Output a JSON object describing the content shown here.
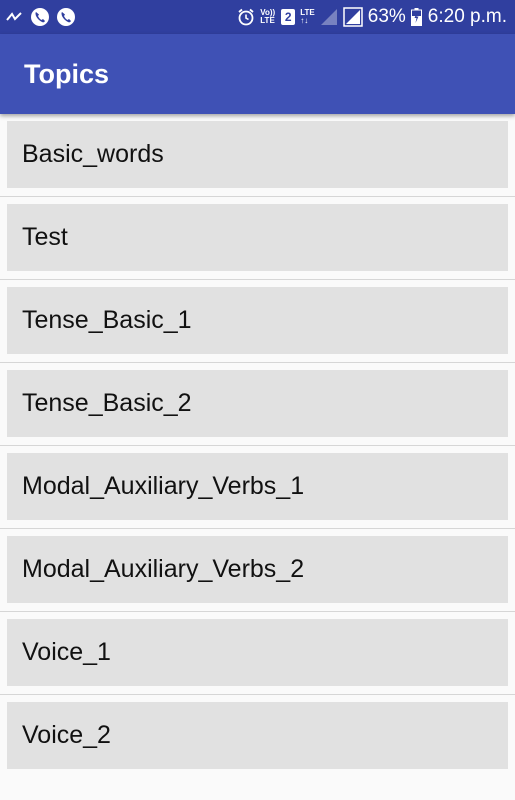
{
  "status_bar": {
    "signal_text": "63%",
    "time": "6:20 p.m.",
    "sim_slot": "2",
    "volte_label_top": "Vo))",
    "volte_label_bottom": "LTE",
    "lte_label": "LTE",
    "icons": [
      "missed-call-icon",
      "phone-icon",
      "phone-icon",
      "alarm-icon",
      "volte-icon",
      "sim-icon",
      "lte-icon",
      "signal-icon",
      "signal-icon",
      "battery-icon"
    ]
  },
  "app_bar": {
    "title": "Topics",
    "color": "#3f51b5",
    "status_color": "#303f9f"
  },
  "topics": [
    {
      "label": "Basic_words"
    },
    {
      "label": "Test"
    },
    {
      "label": "Tense_Basic_1"
    },
    {
      "label": "Tense_Basic_2"
    },
    {
      "label": "Modal_Auxiliary_Verbs_1"
    },
    {
      "label": "Modal_Auxiliary_Verbs_2"
    },
    {
      "label": "Voice_1"
    },
    {
      "label": "Voice_2"
    }
  ]
}
